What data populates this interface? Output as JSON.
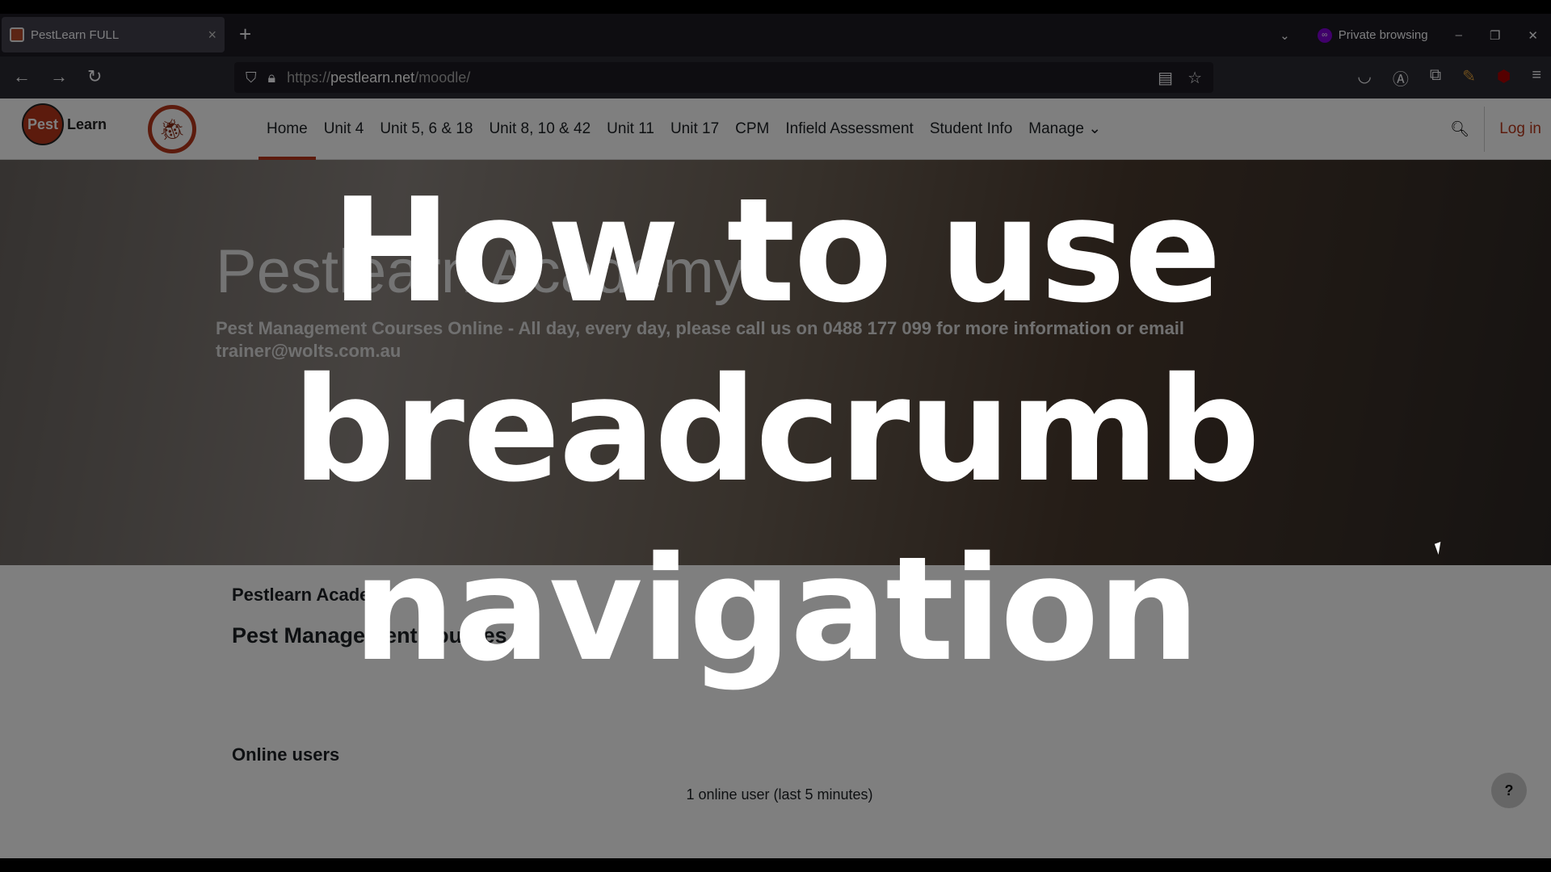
{
  "browser": {
    "tab_title": "PestLearn FULL",
    "new_tab": "+",
    "list_tabs": "⌄",
    "private": "Private browsing",
    "url_prefix": "https://",
    "url_domain": "pestlearn.net",
    "url_path": "/moodle/",
    "minimize": "–",
    "restore": "❐",
    "close": "✕"
  },
  "site": {
    "logo_pest": "Pest",
    "logo_learn": "Learn",
    "menu": [
      "Home",
      "Unit 4",
      "Unit 5, 6 & 18",
      "Unit 8, 10 & 42",
      "Unit 11",
      "Unit 17",
      "CPM",
      "Infield Assessment",
      "Student Info",
      "Manage ⌄"
    ],
    "login": "Log in"
  },
  "hero": {
    "title": "Pestlearn Academy",
    "subtitle": "Pest Management Courses Online - All day, every day, please call us on 0488 177 099 for more information or email trainer@wolts.com.au"
  },
  "content": {
    "site_name": "Pestlearn Academy",
    "summary": "Pest Management courses.",
    "online_heading": "Online users",
    "online_count": "1 online user (last 5 minutes)",
    "help": "?"
  },
  "overlay": {
    "lines": [
      "How to use",
      "breadcrumb",
      "navigation"
    ]
  },
  "colors": {
    "accent": "#b8361a",
    "private": "#8000d7"
  }
}
